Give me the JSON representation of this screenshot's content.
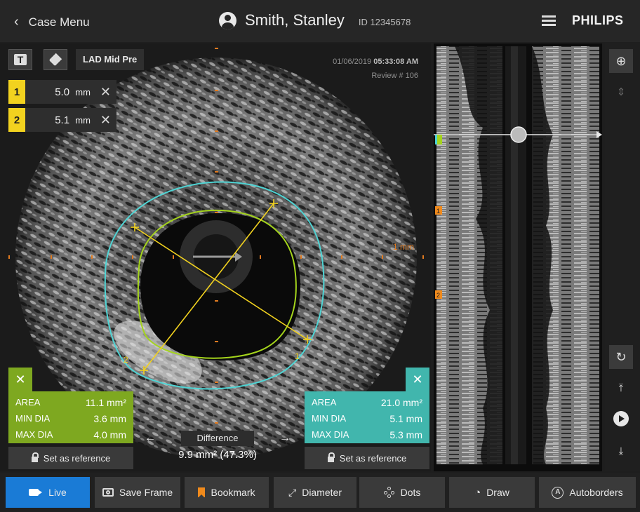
{
  "header": {
    "back_label": "Case Menu",
    "patient_name": "Smith, Stanley",
    "patient_id": "ID 12345678",
    "brand": "PHILIPS"
  },
  "ivus": {
    "segment_label": "LAD Mid Pre",
    "date": "01/06/2019",
    "time": "05:33:08 AM",
    "review": "Review # 106",
    "scale_label": "1 mm",
    "measurements": [
      {
        "index": "1",
        "value": "5.0",
        "unit": "mm"
      },
      {
        "index": "2",
        "value": "5.1",
        "unit": "mm"
      }
    ],
    "diameter_endpoint_labels": [
      "2",
      "1"
    ]
  },
  "lumen_stats": {
    "close": "✕",
    "area_label": "AREA",
    "area_value": "11.1 mm²",
    "min_label": "MIN DIA",
    "min_value": "3.6 mm",
    "max_label": "MAX DIA",
    "max_value": "4.0 mm",
    "reference_label": "Set as reference"
  },
  "vessel_stats": {
    "close": "✕",
    "area_label": "AREA",
    "area_value": "21.0 mm²",
    "min_label": "MIN DIA",
    "min_value": "5.1 mm",
    "max_label": "MAX DIA",
    "max_value": "5.3 mm",
    "reference_label": "Set as reference"
  },
  "difference": {
    "title": "Difference",
    "value": "9.9 mm² (47.3%)"
  },
  "longitudinal": {
    "bookmarks": [
      "1",
      "2"
    ]
  },
  "toolbar": {
    "live": "Live",
    "save_frame": "Save Frame",
    "bookmark": "Bookmark",
    "diameter": "Diameter",
    "dots": "Dots",
    "draw": "Draw",
    "autoborders": "Autoborders"
  },
  "colors": {
    "lumen": "#a4d41c",
    "vessel": "#4fd4d4",
    "measure": "#f2d21f",
    "live": "#1a7bd6",
    "bookmark": "#f08a1c"
  }
}
